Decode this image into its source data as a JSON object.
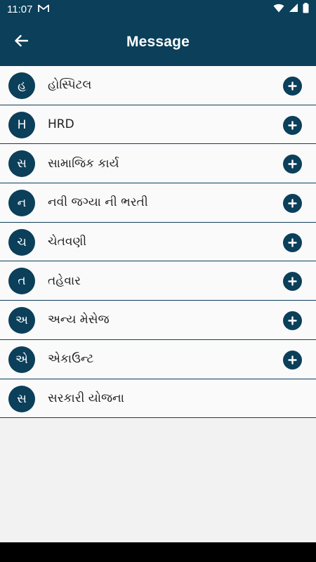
{
  "status": {
    "time": "11:07",
    "notification_icon": "gmail-icon",
    "icons": [
      "wifi-icon",
      "signal-icon",
      "battery-icon"
    ]
  },
  "header": {
    "title": "Message",
    "back_icon": "back-arrow-icon"
  },
  "items": [
    {
      "initial": "હ",
      "label": "હોસ્પિટલ",
      "has_add": true
    },
    {
      "initial": "H",
      "label": "HRD",
      "has_add": true
    },
    {
      "initial": "સ",
      "label": "સામાજિક કાર્ય",
      "has_add": true
    },
    {
      "initial": "ન",
      "label": "નવી જગ્યા ની ભરતી",
      "has_add": true
    },
    {
      "initial": "ચ",
      "label": "ચેતવણી",
      "has_add": true
    },
    {
      "initial": "ત",
      "label": "તહેવાર",
      "has_add": true
    },
    {
      "initial": "અ",
      "label": "અન્ય મેસેજ",
      "has_add": true
    },
    {
      "initial": "એ",
      "label": "એકાઉન્ટ",
      "has_add": true
    },
    {
      "initial": "સ",
      "label": "સરકારી યોજના",
      "has_add": false
    }
  ],
  "colors": {
    "primary": "#0b3f5a",
    "list_background": "#fafafa",
    "page_background": "#f2f2f2"
  }
}
